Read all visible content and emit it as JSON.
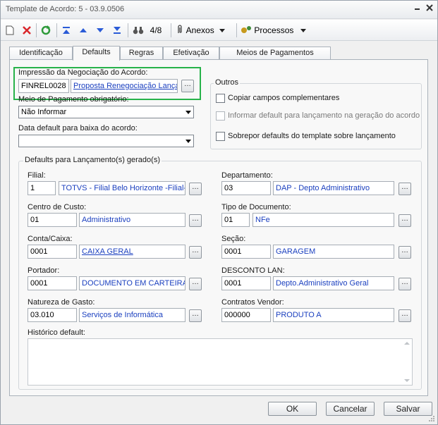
{
  "window": {
    "title": "Template de Acordo: 5 - 03.9.0506"
  },
  "toolbar": {
    "page_counter": "4/8",
    "anexos_label": "Anexos",
    "processos_label": "Processos"
  },
  "tabs": [
    {
      "label": "Identificação"
    },
    {
      "label": "Defaults"
    },
    {
      "label": "Regras"
    },
    {
      "label": "Efetivação"
    },
    {
      "label": "Meios de Pagamentos"
    }
  ],
  "impressao": {
    "label": "Impressão da Negociação do Acordo:",
    "code": "FINREL0028",
    "description": "Proposta Renegociação Lança"
  },
  "meio_pagamento": {
    "label": "Meio de Pagamento obrigatório:",
    "value": "Não Informar"
  },
  "data_baixa": {
    "label": "Data default para baixa do acordo:",
    "value": ""
  },
  "outros": {
    "title": "Outros",
    "items": [
      {
        "label": "Copiar campos complementares",
        "checked": false,
        "enabled": true
      },
      {
        "label": "Informar default para lançamento na geração do acordo",
        "checked": false,
        "enabled": false
      },
      {
        "label": "Sobrepor defaults do template sobre lançamento",
        "checked": false,
        "enabled": true
      }
    ]
  },
  "defaults": {
    "title": "Defaults para Lançamento(s) gerado(s)",
    "left": [
      {
        "label": "Filial:",
        "code": "1",
        "desc": "TOTVS - Filial Belo Horizonte -Filial-",
        "link": false
      },
      {
        "label": "Centro de Custo:",
        "code": "01",
        "desc": "Administrativo",
        "link": false
      },
      {
        "label": "Conta/Caixa:",
        "code": "0001",
        "desc": "CAIXA GERAL",
        "link": true
      },
      {
        "label": "Portador:",
        "code": "0001",
        "desc": "DOCUMENTO EM CARTEIRA",
        "link": false
      },
      {
        "label": "Natureza de Gasto:",
        "code": "03.010",
        "desc": "Serviços de Informática",
        "link": false
      }
    ],
    "right": [
      {
        "label": "Departamento:",
        "code": "03",
        "desc": "DAP - Depto Administrativo",
        "link": false
      },
      {
        "label": "Tipo de Documento:",
        "code": "01",
        "desc": "NFe",
        "link": false
      },
      {
        "label": "Seção:",
        "code": "0001",
        "desc": "GARAGEM",
        "link": false
      },
      {
        "label": "DESCONTO LAN:",
        "code": "0001",
        "desc": "Depto.Administrativo Geral",
        "link": false
      },
      {
        "label": "Contratos Vendor:",
        "code": "000000",
        "desc": "PRODUTO A",
        "link": false
      }
    ],
    "historico_label": "Histórico default:",
    "historico_value": ""
  },
  "footer": {
    "ok_label": "OK",
    "cancel_label": "Cancelar",
    "save_label": "Salvar"
  },
  "colors": {
    "highlight": "#27b24a",
    "link": "#1a3fbf"
  }
}
